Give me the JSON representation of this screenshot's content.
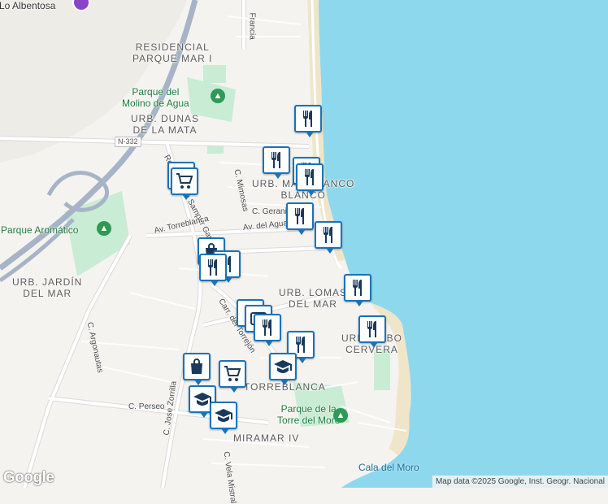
{
  "map": {
    "colors": {
      "sea": "#8ed8ee",
      "land": "#f4f3f0",
      "sand": "#f2ead4",
      "park": "#c9ecd4",
      "road": "#ffffff",
      "motorway": "#a7b3c6",
      "pin": "#1a73b8"
    },
    "area_labels": {
      "lo_albentosa": "Lo Albentosa",
      "residencial_1": "RESIDENCIAL",
      "residencial_2": "PARQUE MAR I",
      "dunas_1": "URB. DUNAS",
      "dunas_2": "DE LA MATA",
      "mar_blanco_1": "URB. MAR BLANCO",
      "mar_blanco_2": "BLANCO",
      "jardin_1": "URB. JARDÍN",
      "jardin_2": "DEL MAR",
      "lomas_1": "URB. LOMAS",
      "lomas_2": "DEL MAR",
      "cabo_1": "URB. CABO",
      "cabo_2": "CERVERA",
      "torreblanca_1": "URB.",
      "torreblanca_2": "TORREBLANCA",
      "miramar": "MIRAMAR IV"
    },
    "parks": {
      "molino_1": "Parque del",
      "molino_2": "Molino de Agua",
      "aromatico": "Parque Aromático",
      "torre_1": "Parque de la",
      "torre_2": "Torre del Moro"
    },
    "streets": {
      "samper": "Rda. de José Samper García",
      "mimosas": "C. Mimosas",
      "torreblanca": "Av. Torreblanca",
      "geranios": "C. Geranios",
      "agua": "Av. del Agua",
      "torrejon": "Carr. del Torrejón",
      "argonautas": "C. Argonautas",
      "perseo": "C. Perseo",
      "zorrilla": "C. Jose Zorrilla",
      "mistral": "C. Vela Mistral",
      "francia": "Francia"
    },
    "highway_shield": "N-332",
    "beach": "Cala del Moro",
    "google_logo": "Google",
    "attribution": "Map data ©2025 Google, Inst. Geogr. Nacional"
  },
  "markers": [
    {
      "id": "restaurant-1",
      "type": "restaurant",
      "icon": "fork-knife-icon"
    },
    {
      "id": "restaurant-2",
      "type": "restaurant",
      "icon": "fork-knife-icon"
    },
    {
      "id": "restaurant-3",
      "type": "restaurant",
      "icon": "fork-knife-icon"
    },
    {
      "id": "restaurant-4",
      "type": "restaurant",
      "icon": "fork-knife-icon"
    },
    {
      "id": "restaurant-5",
      "type": "restaurant",
      "icon": "fork-knife-icon"
    },
    {
      "id": "restaurant-6",
      "type": "restaurant",
      "icon": "fork-knife-icon"
    },
    {
      "id": "restaurant-7",
      "type": "restaurant",
      "icon": "fork-knife-icon"
    },
    {
      "id": "restaurant-8",
      "type": "restaurant",
      "icon": "fork-knife-icon"
    },
    {
      "id": "restaurant-9",
      "type": "restaurant",
      "icon": "fork-knife-icon"
    },
    {
      "id": "restaurant-10",
      "type": "restaurant",
      "icon": "fork-knife-icon"
    },
    {
      "id": "restaurant-11",
      "type": "restaurant",
      "icon": "fork-knife-icon"
    },
    {
      "id": "restaurant-12",
      "type": "restaurant",
      "icon": "fork-knife-icon"
    },
    {
      "id": "restaurant-13",
      "type": "restaurant",
      "icon": "fork-knife-icon"
    },
    {
      "id": "supermarket-1",
      "type": "supermarket",
      "icon": "shopping-cart-icon"
    },
    {
      "id": "supermarket-2",
      "type": "supermarket",
      "icon": "shopping-cart-icon"
    },
    {
      "id": "shop-1",
      "type": "shop",
      "icon": "shopping-bag-icon"
    },
    {
      "id": "shop-2",
      "type": "shop",
      "icon": "shopping-bag-icon"
    },
    {
      "id": "school-1",
      "type": "school",
      "icon": "graduation-cap-icon"
    },
    {
      "id": "school-2",
      "type": "school",
      "icon": "graduation-cap-icon"
    },
    {
      "id": "school-3",
      "type": "school",
      "icon": "graduation-cap-icon"
    },
    {
      "id": "atm-1",
      "type": "atm",
      "icon": "atm-icon"
    }
  ]
}
